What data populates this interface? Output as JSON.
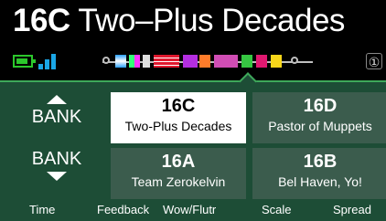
{
  "header": {
    "preset_number": "16C",
    "preset_name": "Two–Plus Decades",
    "icons": [
      "battery-icon",
      "signal-icon",
      "signal-chain-icon",
      "snapshot-icon"
    ],
    "snapshot_label": "①"
  },
  "bank_up": {
    "label": "BANK"
  },
  "bank_down": {
    "label": "BANK"
  },
  "presets": [
    {
      "number": "16C",
      "name": "Two-Plus Decades",
      "active": true
    },
    {
      "number": "16D",
      "name": "Pastor of Muppets",
      "active": false
    },
    {
      "number": "16A",
      "name": "Team Zerokelvin",
      "active": false
    },
    {
      "number": "16B",
      "name": "Bel Haven, Yo!",
      "active": false
    }
  ],
  "knobs": [
    "Time",
    "Feedback",
    "Wow/Flutr",
    "Scale",
    "Spread"
  ],
  "colors": {
    "panel": "#1d4d36",
    "preset_tile": "#3b5c4d",
    "active_tile": "#ffffff",
    "accent_green": "#3ea85a",
    "battery": "#2cc82c",
    "signal": "#1aa6e6"
  }
}
